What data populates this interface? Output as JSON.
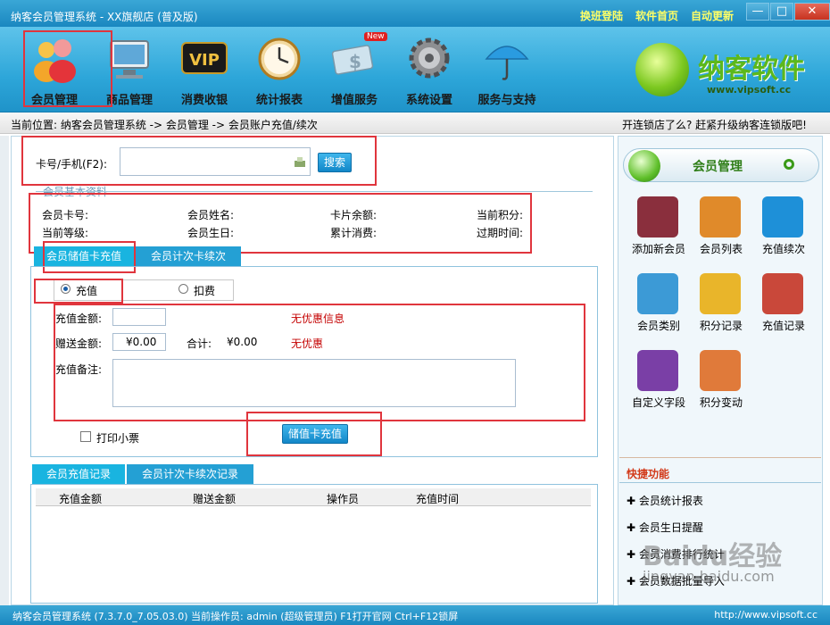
{
  "window": {
    "title": "纳客会员管理系统 - XX旗舰店 (普及版)",
    "links": [
      "换班登陆",
      "软件首页",
      "自动更新"
    ],
    "buttons": {
      "minimize": "—",
      "maximize": "□",
      "close": "✕"
    }
  },
  "toolbar": {
    "items": [
      {
        "label": "会员管理",
        "icon": "member-icon"
      },
      {
        "label": "商品管理",
        "icon": "goods-icon"
      },
      {
        "label": "消费收银",
        "icon": "vip-icon"
      },
      {
        "label": "统计报表",
        "icon": "clock-report-icon"
      },
      {
        "label": "增值服务",
        "icon": "value-added-icon",
        "badge": "New"
      },
      {
        "label": "系统设置",
        "icon": "gear-icon"
      },
      {
        "label": "服务与支持",
        "icon": "umbrella-icon"
      }
    ],
    "logo": {
      "text": "纳客软件",
      "url": "www.vipsoft.cc"
    }
  },
  "breadcrumb": {
    "text": "当前位置: 纳客会员管理系统 -> 会员管理 -> 会员账户充值/续次",
    "promo": "开连锁店了么? 赶紧升级纳客连锁版吧!"
  },
  "search": {
    "label": "卡号/手机(F2):",
    "value": "",
    "button": "搜索"
  },
  "basic_info": {
    "section_title": "会员基本资料",
    "fields": [
      "会员卡号:",
      "会员姓名:",
      "卡片余额:",
      "当前积分:",
      "当前等级:",
      "会员生日:",
      "累计消费:",
      "过期时间:"
    ]
  },
  "recharge_tabs": [
    "会员储值卡充值",
    "会员计次卡续次"
  ],
  "mode": {
    "options": [
      "充值",
      "扣费"
    ],
    "selected": "充值"
  },
  "form": {
    "amount_label": "充值金额:",
    "amount_value": "",
    "discount_info": "无优惠信息",
    "bonus_label": "赠送金额:",
    "bonus_value": "¥0.00",
    "total_label": "合计:",
    "total_value": "¥0.00",
    "discount_none": "无优惠",
    "remark_label": "充值备注:",
    "remark_value": "",
    "print_label": "打印小票",
    "submit": "储值卡充值"
  },
  "records": {
    "tabs": [
      "会员充值记录",
      "会员计次卡续次记录"
    ],
    "columns": [
      "充值金额",
      "赠送金额",
      "操作员",
      "充值时间"
    ]
  },
  "side": {
    "title": "会员管理",
    "items": [
      {
        "label": "添加新会员",
        "icon": "add-member-icon",
        "color": "#8a2f3d"
      },
      {
        "label": "会员列表",
        "icon": "member-list-icon",
        "color": "#e08a2a"
      },
      {
        "label": "充值续次",
        "icon": "dollar-icon",
        "color": "#1e90d8"
      },
      {
        "label": "会员类别",
        "icon": "door-icon",
        "color": "#3c9ad6"
      },
      {
        "label": "积分记录",
        "icon": "truck-icon",
        "color": "#e9b52a"
      },
      {
        "label": "充值记录",
        "icon": "search-record-icon",
        "color": "#c9483a"
      },
      {
        "label": "自定义字段",
        "icon": "pin-icon",
        "color": "#7a3fa6"
      },
      {
        "label": "积分变动",
        "icon": "refresh-icon",
        "color": "#e07a3a"
      }
    ],
    "quick_title": "快捷功能",
    "quick_items": [
      "会员统计报表",
      "会员生日提醒",
      "会员消费排行统计",
      "会员数据批量导入"
    ]
  },
  "status": {
    "text": "纳客会员管理系统 (7.3.7.0_7.05.03.0)  当前操作员: admin (超级管理员)  F1打开官网 Ctrl+F12锁屏",
    "url": "http://www.vipsoft.cc"
  },
  "watermark": {
    "main": "Baidu经验",
    "sub": "jingyan.baidu.com"
  }
}
